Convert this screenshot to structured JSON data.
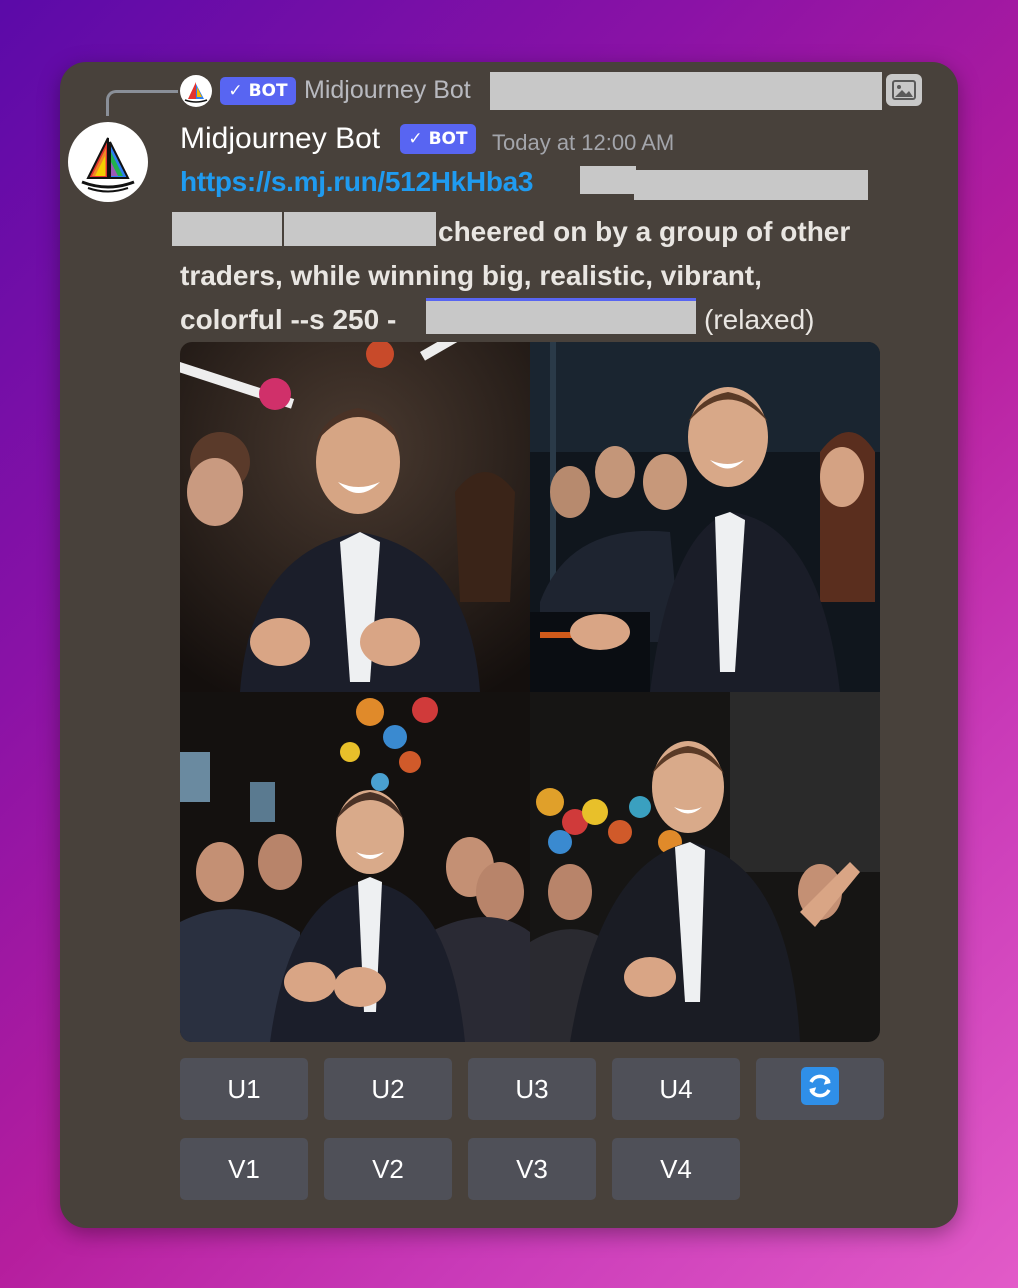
{
  "reply": {
    "bot_tag": "✓ BOT",
    "author": "Midjourney Bot",
    "image_icon": "image-icon"
  },
  "message": {
    "author": "Midjourney Bot",
    "bot_tag": "✓ BOT",
    "timestamp": "Today at 12:00 AM",
    "link": "https://s.mj.run/512HkHba3",
    "prompt_line1": "cheered on by a group of other",
    "prompt_line2": "traders, while winning big, realistic, vibrant,",
    "prompt_line3": "colorful --s 250 -",
    "mode": "(relaxed)"
  },
  "images": {
    "count": 4,
    "subjects": [
      "trader-celebrating-1",
      "trader-celebrating-2",
      "trader-celebrating-3",
      "trader-celebrating-4"
    ]
  },
  "buttons": {
    "upscale": [
      "U1",
      "U2",
      "U3",
      "U4"
    ],
    "variation": [
      "V1",
      "V2",
      "V3",
      "V4"
    ],
    "reroll_icon": "refresh-icon"
  },
  "colors": {
    "card_bg": "#48413b",
    "bot_tag": "#5865f2",
    "link": "#1f9bf0",
    "button_bg": "#4f5058",
    "reroll_blue": "#2f8fe8"
  }
}
